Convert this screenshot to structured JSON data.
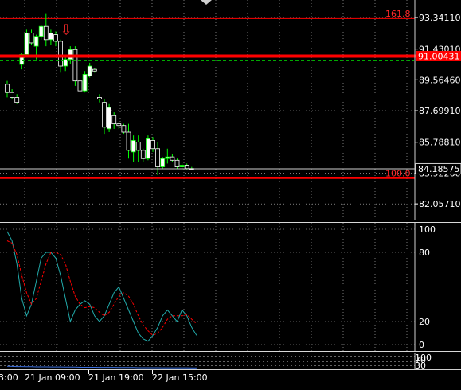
{
  "price_axis": {
    "labels": [
      "93.34110",
      "91.43010",
      "89.56460",
      "87.69910",
      "85.78810",
      "83.92260",
      "82.05710"
    ],
    "levels": [
      93.3411,
      91.4301,
      89.5646,
      87.6991,
      85.7881,
      83.9226,
      82.0571
    ],
    "ylim": [
      81.1,
      94.4
    ]
  },
  "current_price": {
    "label": "84.18575",
    "value": 84.18575
  },
  "red_line_marker": {
    "label": "91.00431",
    "value": 91.00431
  },
  "fib_levels": [
    {
      "label": "161.8",
      "value": 93.3
    },
    {
      "label": "100.0",
      "value": 83.62
    }
  ],
  "arrow_marker": {
    "glyph": "⇩",
    "value": 92.2,
    "bar_index": 12
  },
  "colors": {
    "background": "#000000",
    "bull_candle": "#ffffff",
    "bear_candle": "#ffffff",
    "outline": "#00ff00",
    "fib_line": "#ff0000",
    "main_line": "#22aaaa",
    "signal_line": "#ff0000",
    "grid": "#c8c8c8"
  },
  "chart_data": {
    "type": "candlestick",
    "series": [
      {
        "name": "",
        "ohlc": [
          [
            89.3,
            89.5,
            88.5,
            88.8
          ],
          [
            88.8,
            89.0,
            88.4,
            88.5
          ],
          [
            88.5,
            88.7,
            88.1,
            88.2
          ],
          [
            90.5,
            91.2,
            90.2,
            91.1
          ],
          [
            91.1,
            92.6,
            91.0,
            92.4
          ],
          [
            92.4,
            92.6,
            91.7,
            91.8
          ],
          [
            91.6,
            92.3,
            90.8,
            92.2
          ],
          [
            92.2,
            92.9,
            92.0,
            92.8
          ],
          [
            92.8,
            93.6,
            91.6,
            92.0
          ],
          [
            92.0,
            92.6,
            91.7,
            92.4
          ],
          [
            92.3,
            92.5,
            91.6,
            91.9
          ],
          [
            91.9,
            92.0,
            90.0,
            90.4
          ],
          [
            90.4,
            91.0,
            90.1,
            90.8
          ],
          [
            90.8,
            91.6,
            90.5,
            91.4
          ],
          [
            91.4,
            91.6,
            89.2,
            89.5
          ],
          [
            89.5,
            89.8,
            88.5,
            88.9
          ],
          [
            88.9,
            90.1,
            88.8,
            89.9
          ],
          [
            89.8,
            90.6,
            89.7,
            90.4
          ],
          [
            90.2,
            90.3,
            90.0,
            90.1
          ],
          [
            88.5,
            88.7,
            88.2,
            88.4
          ],
          [
            88.2,
            88.4,
            86.3,
            86.7
          ],
          [
            86.6,
            88.1,
            86.4,
            87.9
          ],
          [
            87.4,
            87.6,
            86.6,
            86.9
          ],
          [
            86.9,
            87.0,
            86.6,
            86.8
          ],
          [
            86.8,
            86.9,
            86.3,
            86.4
          ],
          [
            86.4,
            86.9,
            84.8,
            85.3
          ],
          [
            85.2,
            86.2,
            84.6,
            85.9
          ],
          [
            85.8,
            86.2,
            84.6,
            85.3
          ],
          [
            85.3,
            85.4,
            84.6,
            84.8
          ],
          [
            84.8,
            86.2,
            84.7,
            86.0
          ],
          [
            85.9,
            86.1,
            85.2,
            85.4
          ],
          [
            85.4,
            85.8,
            83.8,
            84.3
          ],
          [
            84.3,
            84.9,
            84.2,
            84.8
          ],
          [
            84.8,
            85.4,
            84.5,
            84.9
          ],
          [
            84.9,
            85.1,
            84.6,
            84.7
          ],
          [
            84.7,
            84.8,
            84.2,
            84.3
          ],
          [
            84.3,
            84.5,
            84.1,
            84.4
          ],
          [
            84.4,
            84.5,
            84.1,
            84.2
          ],
          [
            84.2,
            84.3,
            84.1,
            84.18
          ]
        ]
      }
    ]
  },
  "stochastic": {
    "labels": [
      "100",
      "80",
      "20",
      "0"
    ],
    "levels": [
      100,
      80,
      20,
      0
    ],
    "main": [
      98,
      90,
      70,
      40,
      25,
      35,
      55,
      75,
      80,
      80,
      75,
      60,
      40,
      20,
      30,
      35,
      38,
      35,
      25,
      20,
      25,
      35,
      45,
      50,
      40,
      30,
      20,
      10,
      5,
      3,
      8,
      15,
      25,
      30,
      25,
      20,
      30,
      25,
      15,
      8
    ],
    "signal": [
      90,
      88,
      78,
      60,
      45,
      35,
      40,
      55,
      70,
      80,
      80,
      78,
      70,
      55,
      42,
      35,
      32,
      33,
      32,
      28,
      25,
      28,
      35,
      42,
      45,
      42,
      35,
      25,
      17,
      12,
      8,
      10,
      15,
      22,
      25,
      25,
      25,
      26,
      22,
      18
    ]
  },
  "third_pane": {
    "labels": [
      "100",
      "70",
      "30"
    ],
    "series": [
      16,
      15,
      14,
      14,
      13,
      13,
      12,
      12,
      12,
      11,
      11,
      11,
      10,
      10,
      10,
      9,
      9,
      9,
      9,
      8,
      8,
      8,
      8,
      7,
      7,
      7,
      7,
      6,
      6,
      6,
      6,
      6,
      5,
      5,
      5,
      5,
      5,
      5,
      4,
      4
    ]
  },
  "time_axis": {
    "labels": [
      "3:00",
      "21 Jan 09:00",
      "21 Jan 19:00",
      "22 Jan 15:00"
    ]
  }
}
